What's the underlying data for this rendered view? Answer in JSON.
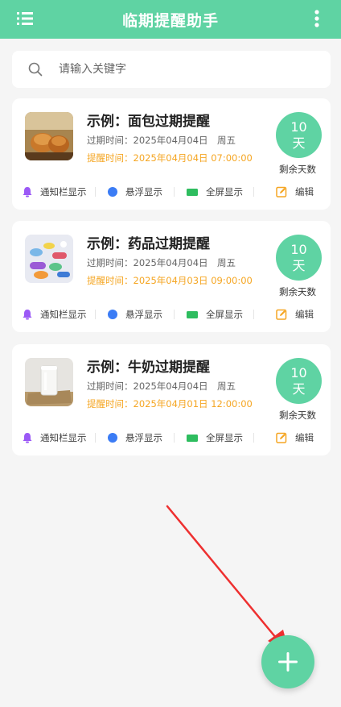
{
  "header": {
    "title": "临期提醒助手",
    "menu_icon": "list-menu-icon",
    "more_icon": "more-vertical-icon"
  },
  "search": {
    "placeholder": "请输入关键字",
    "value": ""
  },
  "cards": [
    {
      "title": "示例：面包过期提醒",
      "expire": "过期时间：2025年04月04日　周五",
      "remind": "提醒时间：2025年04月04日 07:00:00",
      "days": "10",
      "days_unit": "天",
      "days_label": "剩余天数",
      "image": "bread-photo",
      "actions": {
        "notify": "通知栏显示",
        "float": "悬浮显示",
        "full": "全屏显示",
        "edit": "编辑"
      }
    },
    {
      "title": "示例：药品过期提醒",
      "expire": "过期时间：2025年04月04日　周五",
      "remind": "提醒时间：2025年04月03日 09:00:00",
      "days": "10",
      "days_unit": "天",
      "days_label": "剩余天数",
      "image": "pills-photo",
      "actions": {
        "notify": "通知栏显示",
        "float": "悬浮显示",
        "full": "全屏显示",
        "edit": "编辑"
      }
    },
    {
      "title": "示例：牛奶过期提醒",
      "expire": "过期时间：2025年04月04日　周五",
      "remind": "提醒时间：2025年04月01日 12:00:00",
      "days": "10",
      "days_unit": "天",
      "days_label": "剩余天数",
      "image": "milk-photo",
      "actions": {
        "notify": "通知栏显示",
        "float": "悬浮显示",
        "full": "全屏显示",
        "edit": "编辑"
      }
    }
  ],
  "fab": {
    "icon": "plus-icon"
  },
  "colors": {
    "accent": "#5fd3a3",
    "remind": "#f5a623",
    "bell": "#9b59f6",
    "float_dot": "#3b7cf5",
    "full_screen": "#2ebd5f",
    "edit": "#f5a623"
  }
}
